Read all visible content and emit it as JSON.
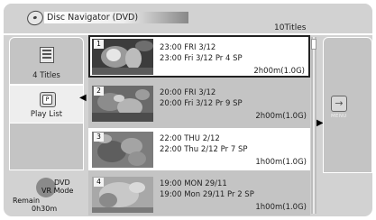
{
  "header": {
    "title": "Disc Navigator (DVD)",
    "count": "10Titles"
  },
  "sidebar": {
    "tabs": [
      {
        "label": "4 Titles",
        "icon": "title-list-icon"
      },
      {
        "label": "Play List",
        "icon": "playlist-icon"
      }
    ],
    "mode_line1": "DVD",
    "mode_line2": "VR Mode",
    "remain_label": "Remain",
    "remain_value": "0h30m"
  },
  "titles": [
    {
      "num": "1",
      "line1": "23:00 FRI 3/12",
      "line2": "23:00  Fri  3/12  Pr 4  SP",
      "duration": "2h00m(1.0G)"
    },
    {
      "num": "2",
      "line1": "20:00  FRI  3/12",
      "line2": "20:00  Fri  3/12  Pr 9  SP",
      "duration": "2h00m(1.0G)"
    },
    {
      "num": "3",
      "line1": "22:00  THU  2/12",
      "line2": "22:00  Thu  2/12  Pr 7  SP",
      "duration": "1h00m(1.0G)"
    },
    {
      "num": "4",
      "line1": "19:00  MON  29/11",
      "line2": "19:00  Mon  29/11  Pr 2  SP",
      "duration": "1h00m(1.0G)"
    }
  ],
  "menu": {
    "label": "MENU",
    "icon": "menu-arrow-icon"
  },
  "colors": {
    "panel": "#c4c4c4",
    "frame": "#d2d2d2",
    "highlight": "#ffffff"
  }
}
